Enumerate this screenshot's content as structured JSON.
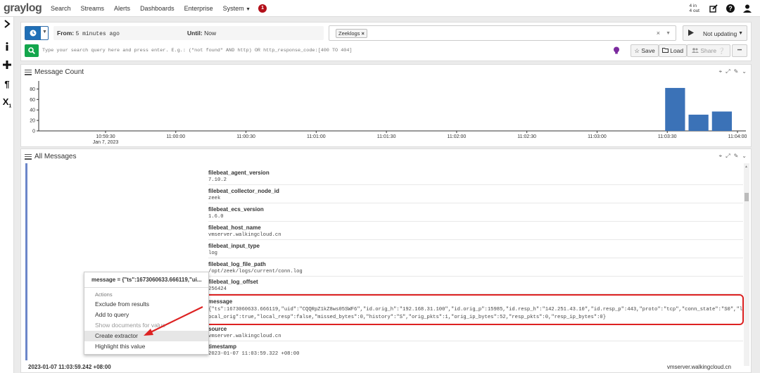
{
  "nav": {
    "logo": "graylog",
    "links": [
      "Search",
      "Streams",
      "Alerts",
      "Dashboards",
      "Enterprise",
      "System"
    ],
    "notification_count": "1",
    "throughput_in": "4 in",
    "throughput_out": "4 out"
  },
  "rail": {
    "icons": [
      "chevron-right-icon",
      "info-icon",
      "plus-icon",
      "pilcrow-icon",
      "subscript-icon"
    ]
  },
  "search": {
    "from_label": "From:",
    "from_value": "5 minutes ago",
    "until_label": "Until:",
    "until_value": "Now",
    "stream_tag": "Zeeklogs",
    "update_label": "Not updating",
    "query_placeholder": "Type your search query here and press enter. E.g.: (\"not found\" AND http) OR http_response_code:[400 TO 404]",
    "save_label": "Save",
    "load_label": "Load",
    "share_label": "Share",
    "more_label": "•••"
  },
  "message_count": {
    "title": "Message Count",
    "chart_data": {
      "type": "bar",
      "title": "Message Count",
      "xlabel": "",
      "ylabel": "",
      "ylim": [
        0,
        90
      ],
      "y_ticks": [
        0,
        20,
        40,
        60,
        80
      ],
      "x_tick_labels": [
        "10:59:30",
        "11:00:00",
        "11:00:30",
        "11:01:00",
        "11:01:30",
        "11:02:00",
        "11:02:30",
        "11:03:00",
        "11:03:30",
        "11:04:00"
      ],
      "x_date_label": "Jan 7, 2023",
      "bars": [
        {
          "time": "11:03:30",
          "value": 82
        },
        {
          "time": "11:03:40",
          "value": 31
        },
        {
          "time": "11:03:50",
          "value": 37
        }
      ],
      "color": "#3b72b7"
    }
  },
  "all_messages": {
    "title": "All Messages",
    "fields": [
      {
        "name": "filebeat_agent_version",
        "value": "7.10.2"
      },
      {
        "name": "filebeat_collector_node_id",
        "value": "zeek"
      },
      {
        "name": "filebeat_ecs_version",
        "value": "1.6.0"
      },
      {
        "name": "filebeat_host_name",
        "value": "vmserver.walkingcloud.cn"
      },
      {
        "name": "filebeat_input_type",
        "value": "log"
      },
      {
        "name": "filebeat_log_file_path",
        "value": "/opt/zeek/logs/current/conn.log"
      },
      {
        "name": "filebeat_log_offset",
        "value": "256424"
      }
    ],
    "message_field": {
      "name": "message",
      "value": "{\"ts\":1673060633.666119,\"uid\":\"CQQRpZ1kZ8ws05SWF6\",\"id.orig_h\":\"192.168.31.100\",\"id.orig_p\":15985,\"id.resp_h\":\"142.251.43.10\",\"id.resp_p\":443,\"proto\":\"tcp\",\"conn_state\":\"S0\",\"local_orig\":true,\"local_resp\":false,\"missed_bytes\":0,\"history\":\"S\",\"orig_pkts\":1,\"orig_ip_bytes\":52,\"resp_pkts\":0,\"resp_ip_bytes\":0}"
    },
    "source_field": {
      "name": "source",
      "value": "vmserver.walkingcloud.cn"
    },
    "timestamp_field": {
      "name": "timestamp",
      "value": "2023-01-07 11:03:59.322 +08:00"
    },
    "next_timestamp": "2023-01-07 11:03:59.242 +08:00",
    "next_source": "vmserver.walkingcloud.cn"
  },
  "context_menu": {
    "title": "message = {\"ts\":1673060633.666119,\"ui...",
    "section": "Actions",
    "items": [
      "Exclude from results",
      "Add to query",
      "Show documents for value",
      "Create extractor",
      "Highlight this value"
    ]
  },
  "colors": {
    "accent": "#1f6fb6",
    "success": "#13a64c",
    "bar": "#3b72b7",
    "highlight": "#dd2222",
    "badge": "#b3101a"
  }
}
